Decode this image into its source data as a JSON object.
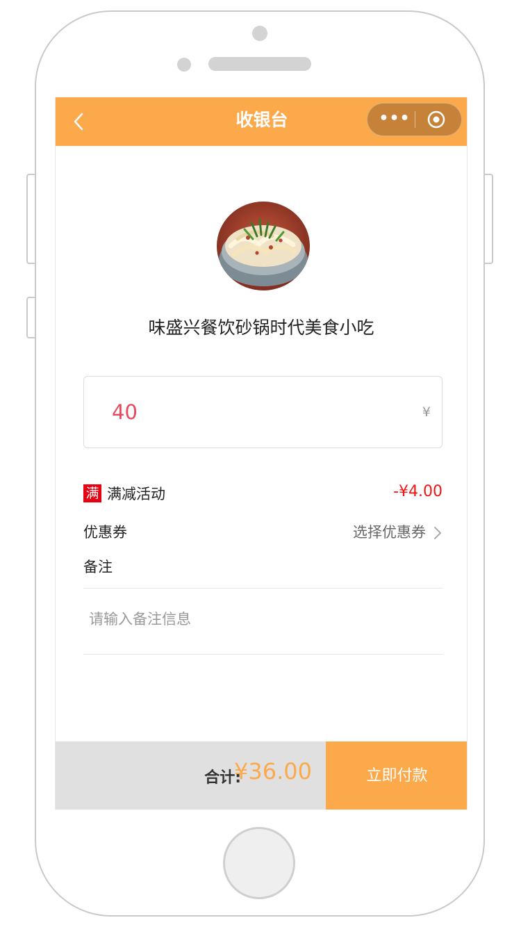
{
  "navbar": {
    "title": "收银台",
    "back_icon": "chevron-left-icon",
    "more_icon": "more-dots-icon",
    "more_glyph": "•••",
    "close_icon": "target-circle-icon",
    "color": "#fba94b"
  },
  "shop": {
    "name": "味盛兴餐饮砂锅时代美食小吃",
    "image": "noodle-dish-photo"
  },
  "amount": {
    "value": "40",
    "currency": "¥"
  },
  "discount": {
    "badge": "满",
    "label": "满减活动",
    "amount": "-¥4.00",
    "color": "#f01414"
  },
  "coupon": {
    "label": "优惠券",
    "action": "选择优惠券",
    "chevron_icon": "chevron-right-icon"
  },
  "note": {
    "label": "备注",
    "placeholder": "请输入备注信息",
    "value": ""
  },
  "footer": {
    "total_label": "合计:",
    "total_value": "¥36.00",
    "pay_label": "立即付款"
  }
}
